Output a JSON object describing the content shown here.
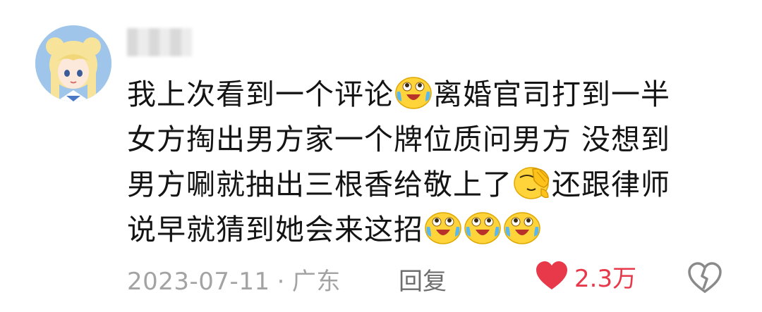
{
  "comment": {
    "text_lines": [
      [
        "我上次看到一个评论",
        "离婚官司打到一半"
      ],
      [
        "女方掏出男方家一个牌位质问男方 没想到"
      ],
      [
        "男方唰就抽出三根香给敬上了",
        "还跟律师"
      ],
      [
        "说早就猜到她会来这招"
      ]
    ],
    "emoji_names": [
      "laugh-cry",
      "facepalm",
      "laugh-cry",
      "laugh-cry",
      "laugh-cry"
    ],
    "date": "2023-07-11",
    "separator": "·",
    "location": "广东",
    "reply_label": "回复",
    "like_count": "2.3万"
  },
  "colors": {
    "like": "#e8394a",
    "meta": "#a3a3a3",
    "text": "#141414"
  }
}
